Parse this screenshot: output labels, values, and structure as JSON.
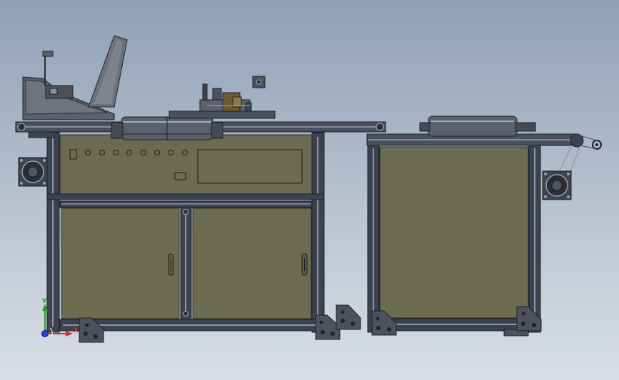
{
  "axes_triad": {
    "y_label": "Y",
    "x_label": "X"
  },
  "colors": {
    "background_top": "#8fa0b7",
    "background_bottom": "#d9dee6",
    "panel_fill": "#6b6c4f",
    "frame_profile": "#3c4250",
    "frame_highlight": "#8f96a4",
    "y_axis": "#2d9b2d",
    "x_axis": "#c83232",
    "z_axis": "#2b3fc7"
  }
}
